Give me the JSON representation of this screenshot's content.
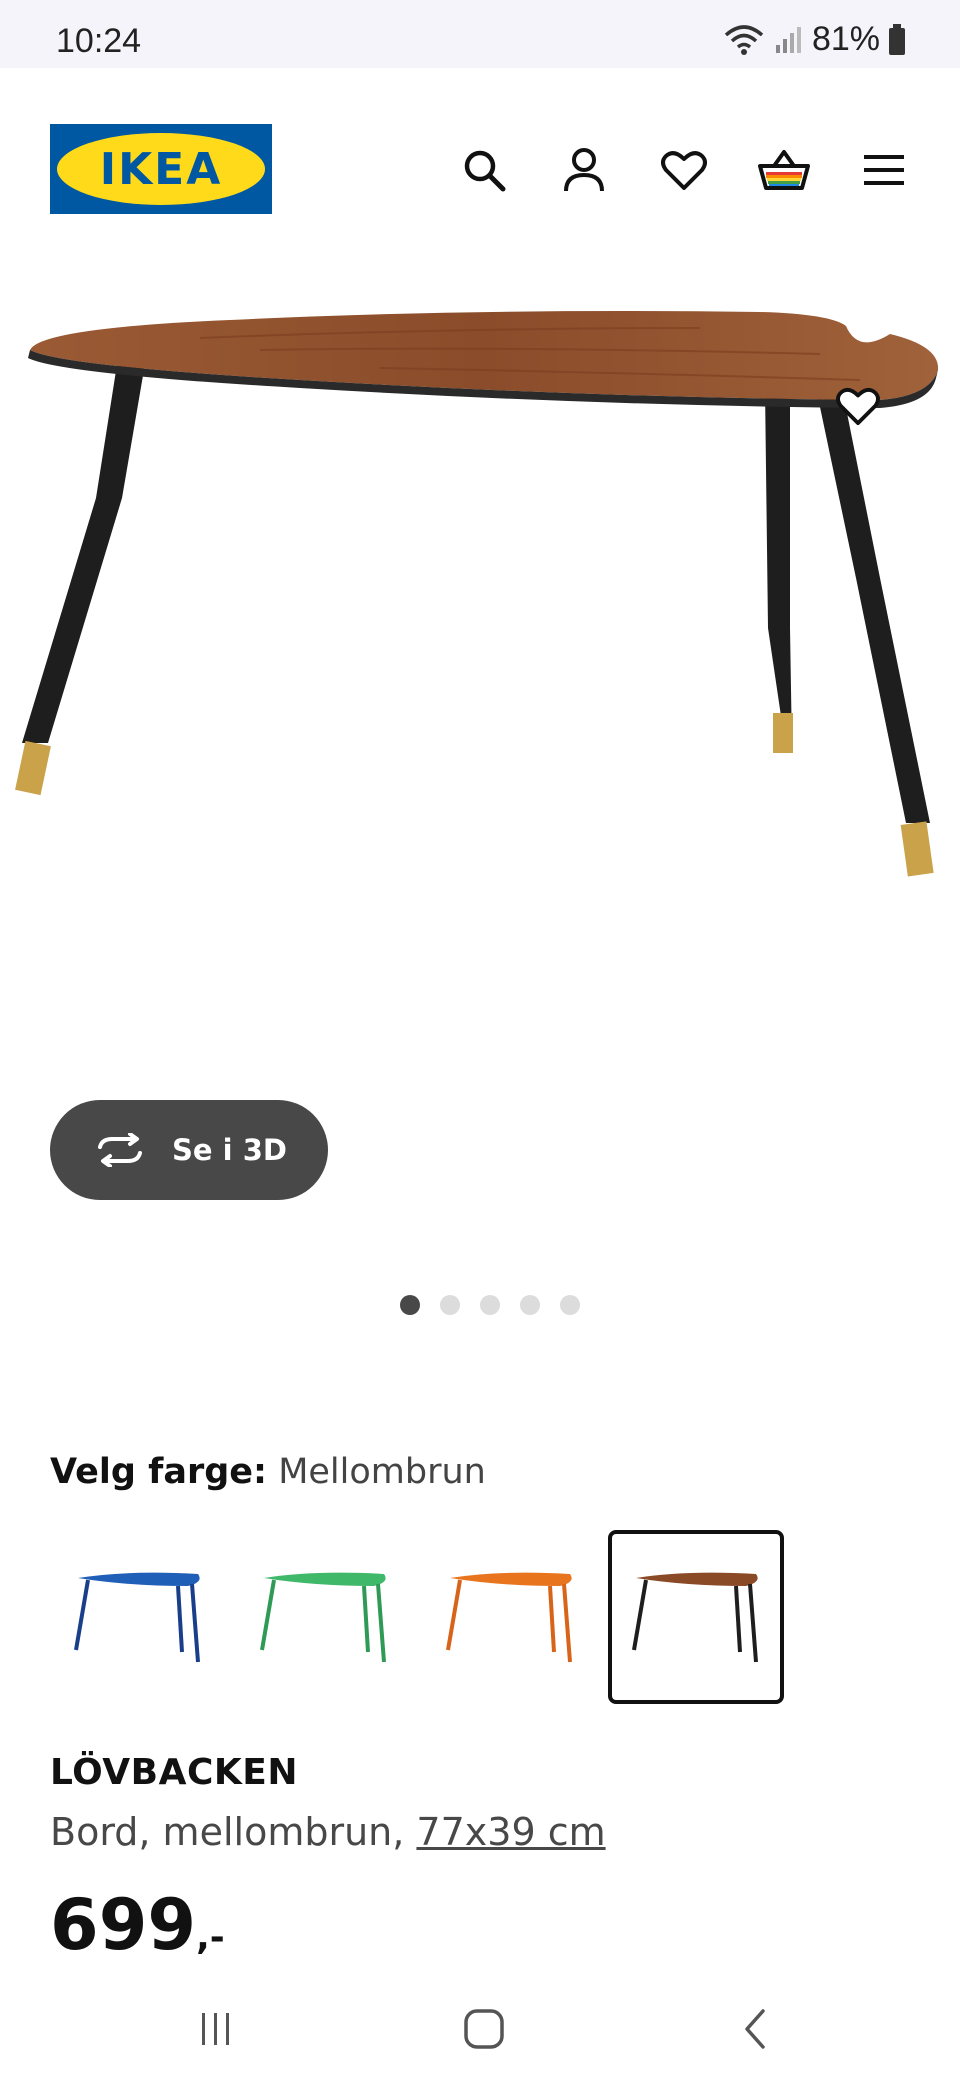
{
  "status_bar": {
    "time": "10:24",
    "battery": "81%"
  },
  "header": {
    "logo_text": "IKEA",
    "icons": [
      "search-icon",
      "account-icon",
      "favorites-icon",
      "cart-icon",
      "menu-icon"
    ]
  },
  "gallery": {
    "view_3d_label": "Se i 3D",
    "image_count": 5,
    "active_index": 0
  },
  "color": {
    "label": "Velg farge:",
    "selected": "Mellombrun",
    "options": [
      "Blå",
      "Grønn",
      "Oransje",
      "Mellombrun"
    ],
    "swatch_colors": [
      "#1f5fb8",
      "#3fb86a",
      "#e8751e",
      "#8a4a26"
    ]
  },
  "product": {
    "name": "LÖVBACKEN",
    "desc_prefix": "Bord, mellombrun,",
    "size": "77x39 cm",
    "price": "699",
    "price_suffix": ",-"
  },
  "colors": {
    "brand_blue": "#0058a3",
    "brand_yellow": "#ffda1a",
    "dark": "#484848"
  }
}
